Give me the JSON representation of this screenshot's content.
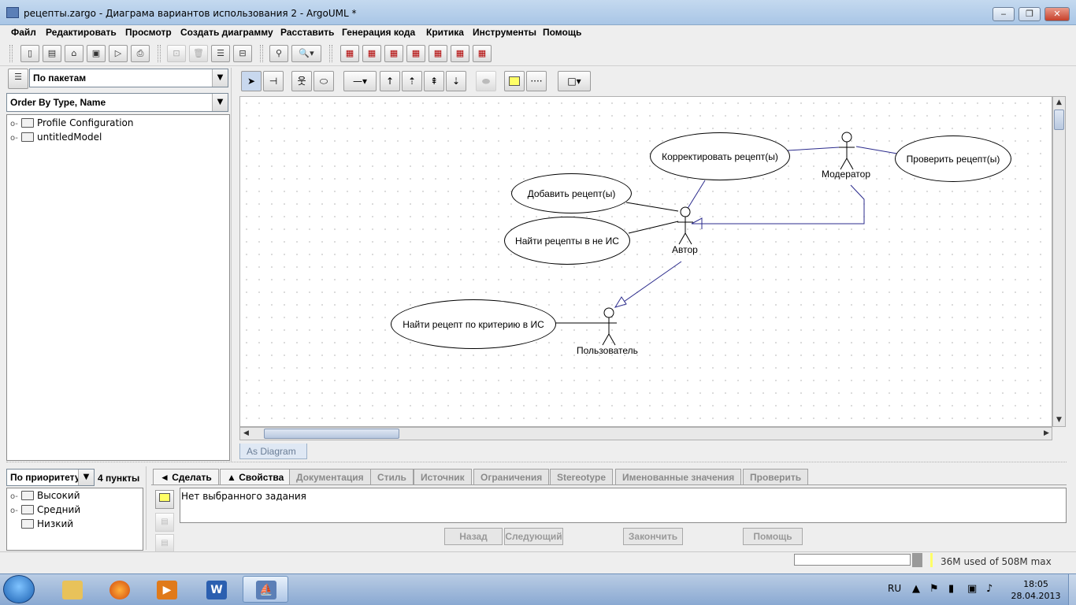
{
  "window": {
    "title": "рецепты.zargo - Диаграма вариантов использования 2 - ArgoUML *",
    "minimize": "‒",
    "restore": "❐",
    "close": "✕"
  },
  "menu": [
    "Файл",
    "Редактировать",
    "Просмотр",
    "Создать диаграмму",
    "Расставить",
    "Генерация кода",
    "Критика",
    "Инструменты",
    "Помощь"
  ],
  "explorer": {
    "perspective": "По пакетам",
    "order": "Order By Type, Name",
    "tree": [
      "Profile Configuration",
      "untitledModel"
    ]
  },
  "diagram": {
    "use_cases": {
      "edit": "Корректировать рецепт(ы)",
      "check": "Проверить рецепт(ы)",
      "add": "Добавить рецепт(ы)",
      "find": "Найти рецепты в не ИС",
      "find_by": "Найти рецепт по критерию в ИС"
    },
    "actors": {
      "moderator": "Модератор",
      "author": "Автор",
      "user": "Пользователь"
    },
    "tab": "As Diagram"
  },
  "todo": {
    "order": "По приоритету",
    "count": "4 пункты",
    "items": [
      "Высокий",
      "Средний",
      "Низкий"
    ]
  },
  "details": {
    "tabs": [
      "◄ Сделать",
      "▲ Свойства",
      "Документация",
      "Стиль",
      "Источник",
      "Ограничения",
      "Stereotype",
      "Именованные значения",
      "Проверить"
    ],
    "message": "Нет выбранного задания",
    "buttons": {
      "back": "Назад",
      "next": "Следующий",
      "finish": "Закончить",
      "help": "Помощь"
    }
  },
  "status": {
    "memory": "36M used of 508M max"
  },
  "taskbar": {
    "lang": "RU",
    "time": "18:05",
    "date": "28.04.2013"
  },
  "colors": {
    "generalization": "#2b2b8c",
    "association": "#000000",
    "note_yellow": "#ffff66"
  }
}
